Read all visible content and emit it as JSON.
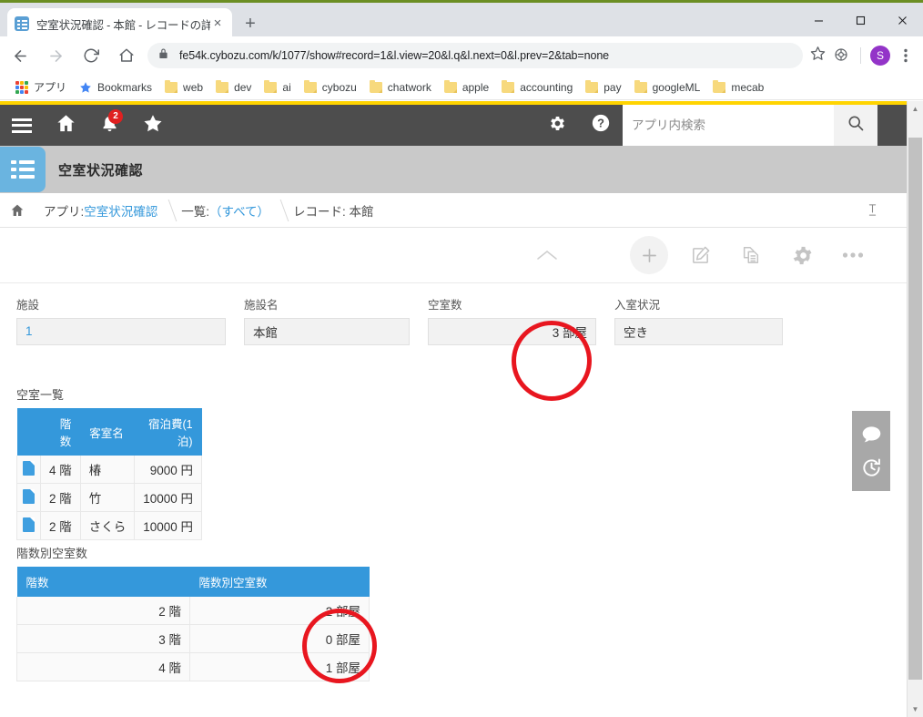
{
  "browser": {
    "tab": {
      "title": "空室状況確認 - 本館 - レコードの詳",
      "close_label": "×"
    },
    "new_tab_label": "+",
    "window": {
      "minimize": "minimize",
      "maximize": "maximize",
      "close": "close"
    },
    "nav": {
      "back": "back-arrow",
      "forward": "forward-arrow",
      "reload": "reload",
      "home": "home"
    },
    "omnibox": {
      "url": "fe54k.cybozu.com/k/1077/show#record=1&l.view=20&l.q&l.next=0&l.prev=2&tab=none",
      "lock_icon": "lock-icon",
      "star_icon": "star-icon",
      "extension_icon": "extension-icon",
      "profile_initial": "S",
      "menu_icon": "three-dot-menu"
    },
    "bookmarks": [
      {
        "label": "アプリ",
        "icon": "apps-grid-icon"
      },
      {
        "label": "Bookmarks",
        "icon": "star-icon"
      },
      {
        "label": "web",
        "icon": "folder-icon"
      },
      {
        "label": "dev",
        "icon": "folder-icon"
      },
      {
        "label": "ai",
        "icon": "folder-icon"
      },
      {
        "label": "cybozu",
        "icon": "folder-icon"
      },
      {
        "label": "chatwork",
        "icon": "folder-icon"
      },
      {
        "label": "apple",
        "icon": "folder-icon"
      },
      {
        "label": "accounting",
        "icon": "folder-icon"
      },
      {
        "label": "pay",
        "icon": "folder-icon"
      },
      {
        "label": "googleML",
        "icon": "folder-icon"
      },
      {
        "label": "mecab",
        "icon": "folder-icon"
      }
    ]
  },
  "kintone": {
    "header": {
      "menu_icon": "hamburger-menu-icon",
      "home_icon": "home-icon",
      "bell_icon": "notification-bell-icon",
      "bell_badge": "2",
      "star_icon": "favorites-star-icon",
      "gear_icon": "settings-gear-icon",
      "help_icon": "help-question-icon",
      "search_placeholder": "アプリ内検索",
      "search_value": "",
      "search_button_icon": "magnifier-icon"
    },
    "app": {
      "icon": "app-list-icon",
      "title": "空室状況確認"
    },
    "breadcrumb": {
      "home_icon": "home-icon",
      "items": [
        {
          "prefix": "アプリ: ",
          "link": "空室状況確認"
        },
        {
          "prefix": "一覧: ",
          "link": "（すべて）"
        },
        {
          "prefix": "レコード: 本館",
          "link": ""
        }
      ],
      "pin_icon": "pin-icon"
    },
    "record_toolbar": [
      {
        "name": "collapse-chevron-icon",
        "label": "^"
      },
      {
        "name": "add-record-icon",
        "label": "+"
      },
      {
        "name": "edit-record-icon",
        "label": "edit"
      },
      {
        "name": "duplicate-record-icon",
        "label": "duplicate"
      },
      {
        "name": "record-settings-gear-icon",
        "label": "gear"
      },
      {
        "name": "more-options-icon",
        "label": "..."
      }
    ],
    "side_panel": [
      {
        "name": "comment-icon",
        "label": "comment"
      },
      {
        "name": "history-icon",
        "label": "history"
      }
    ],
    "fields": [
      {
        "label": "施設",
        "value": "1",
        "align": "left",
        "style": "link"
      },
      {
        "label": "施設名",
        "value": "本館",
        "align": "left",
        "style": "normal"
      },
      {
        "label": "空室数",
        "value": "3 部屋",
        "align": "right",
        "style": "normal"
      },
      {
        "label": "入室状況",
        "value": "空き",
        "align": "left",
        "style": "normal"
      }
    ],
    "rooms_table": {
      "title": "空室一覧",
      "headers": [
        "",
        "階数",
        "客室名",
        "宿泊費(1泊)"
      ],
      "rows": [
        {
          "icon": "record-link-icon",
          "floor": "4 階",
          "room": "椿",
          "price": "9000 円"
        },
        {
          "icon": "record-link-icon",
          "floor": "2 階",
          "room": "竹",
          "price": "10000 円"
        },
        {
          "icon": "record-link-icon",
          "floor": "2 階",
          "room": "さくら",
          "price": "10000 円"
        }
      ]
    },
    "floors_table": {
      "title": "階数別空室数",
      "headers": [
        "階数",
        "階数別空室数"
      ],
      "rows": [
        {
          "floor": "2 階",
          "count": "2 部屋"
        },
        {
          "floor": "3 階",
          "count": "0 部屋"
        },
        {
          "floor": "4 階",
          "count": "1 部屋"
        }
      ]
    }
  },
  "annotations": {
    "color": "#e8161f",
    "circles": [
      {
        "name": "annotation-circle-vacancy-count",
        "target": "空室数 = 3 部屋"
      },
      {
        "name": "annotation-circle-floor-counts",
        "target": "階数別空室数 = 2/0/1 部屋"
      }
    ]
  },
  "scrollbar": {
    "up_arrow": "▲",
    "down_arrow": "▼"
  }
}
